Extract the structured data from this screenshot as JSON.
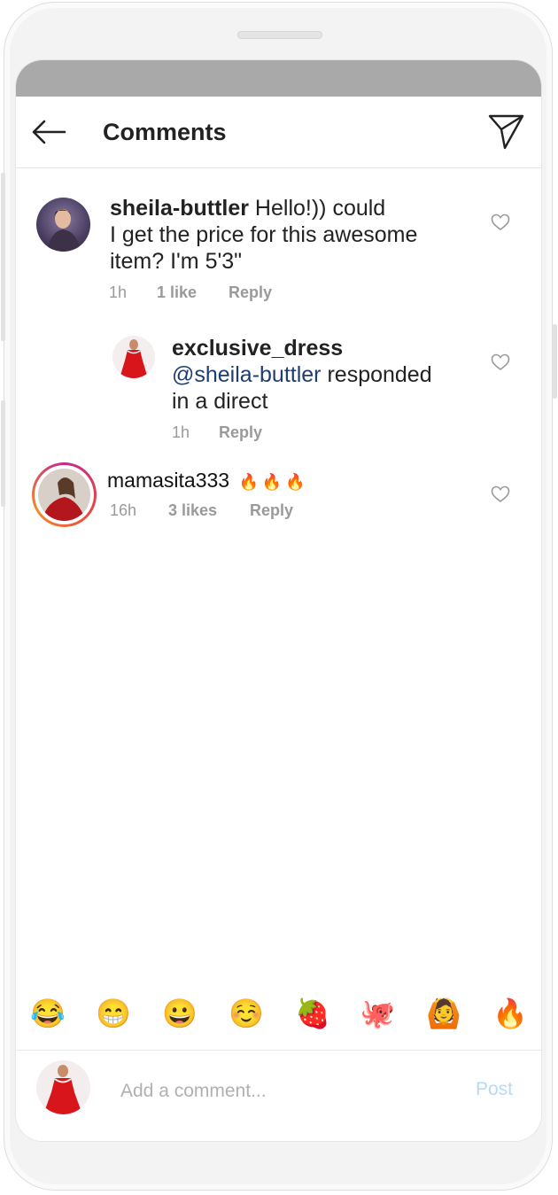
{
  "header": {
    "title": "Comments"
  },
  "comments": [
    {
      "username": "sheila-buttler",
      "text_line1": " Hello!)) could",
      "text_line2": "I get the price for this awesome",
      "text_line3": "item? I'm 5'3\"",
      "time": "1h",
      "likes": "1 like",
      "reply": "Reply"
    },
    {
      "username": "exclusive_dress",
      "mention": "@sheila-buttler",
      "text_line1": " responded",
      "text_line2": "in a direct",
      "time": "1h",
      "reply": "Reply"
    },
    {
      "username": "mamasita333",
      "emojis": "🔥🔥🔥",
      "time": "16h",
      "likes": "3 likes",
      "reply": "Reply"
    }
  ],
  "emoji_bar": [
    "😂",
    "😁",
    "😀",
    "☺️",
    "🍓",
    "🐙",
    "🙆",
    "🔥"
  ],
  "composer": {
    "placeholder": "Add a comment...",
    "post": "Post"
  }
}
